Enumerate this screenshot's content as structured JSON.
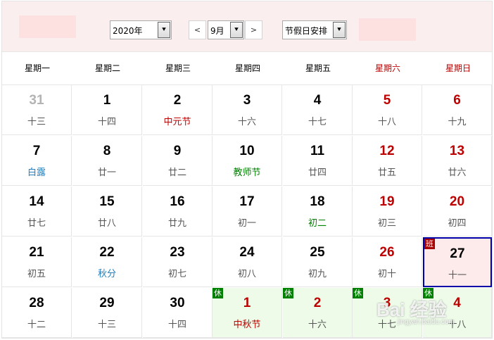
{
  "toolbar": {
    "year_value": "2020年",
    "month_value": "9月",
    "prev_label": "<",
    "next_label": ">",
    "holiday_value": "节假日安排",
    "dropdown_arrow": "⯆"
  },
  "weekdays": [
    "星期一",
    "星期二",
    "星期三",
    "星期四",
    "星期五",
    "星期六",
    "星期日"
  ],
  "weeks": [
    [
      {
        "day": "31",
        "sub": "十三",
        "type": "other"
      },
      {
        "day": "1",
        "sub": "十四"
      },
      {
        "day": "2",
        "sub": "中元节",
        "sub_type": "festival"
      },
      {
        "day": "3",
        "sub": "十六"
      },
      {
        "day": "4",
        "sub": "十七"
      },
      {
        "day": "5",
        "sub": "十八",
        "type": "weekend"
      },
      {
        "day": "6",
        "sub": "十九",
        "type": "weekend"
      }
    ],
    [
      {
        "day": "7",
        "sub": "白露",
        "sub_type": "term"
      },
      {
        "day": "8",
        "sub": "廿一"
      },
      {
        "day": "9",
        "sub": "廿二"
      },
      {
        "day": "10",
        "sub": "教师节",
        "sub_type": "green"
      },
      {
        "day": "11",
        "sub": "廿四"
      },
      {
        "day": "12",
        "sub": "廿五",
        "type": "weekend"
      },
      {
        "day": "13",
        "sub": "廿六",
        "type": "weekend"
      }
    ],
    [
      {
        "day": "14",
        "sub": "廿七"
      },
      {
        "day": "15",
        "sub": "廿八"
      },
      {
        "day": "16",
        "sub": "廿九"
      },
      {
        "day": "17",
        "sub": "初一"
      },
      {
        "day": "18",
        "sub": "初二",
        "sub_type": "green"
      },
      {
        "day": "19",
        "sub": "初三",
        "type": "weekend"
      },
      {
        "day": "20",
        "sub": "初四",
        "type": "weekend"
      }
    ],
    [
      {
        "day": "21",
        "sub": "初五"
      },
      {
        "day": "22",
        "sub": "秋分",
        "sub_type": "term"
      },
      {
        "day": "23",
        "sub": "初七"
      },
      {
        "day": "24",
        "sub": "初八"
      },
      {
        "day": "25",
        "sub": "初九"
      },
      {
        "day": "26",
        "sub": "初十",
        "type": "weekend"
      },
      {
        "day": "27",
        "sub": "十一",
        "type": "selected",
        "badge": "班",
        "badge_type": "work"
      }
    ],
    [
      {
        "day": "28",
        "sub": "十二"
      },
      {
        "day": "29",
        "sub": "十三"
      },
      {
        "day": "30",
        "sub": "十四"
      },
      {
        "day": "1",
        "sub": "中秋节",
        "type": "holiday",
        "sub_type": "festival",
        "badge": "休",
        "badge_type": "rest"
      },
      {
        "day": "2",
        "sub": "十六",
        "type": "holiday",
        "badge": "休",
        "badge_type": "rest"
      },
      {
        "day": "3",
        "sub": "十七",
        "type": "holiday",
        "badge": "休",
        "badge_type": "rest"
      },
      {
        "day": "4",
        "sub": "十八",
        "type": "holiday",
        "badge": "休",
        "badge_type": "rest"
      }
    ]
  ],
  "watermark": {
    "text": "Bai 经验",
    "url": "jingyan.baidu.com"
  }
}
